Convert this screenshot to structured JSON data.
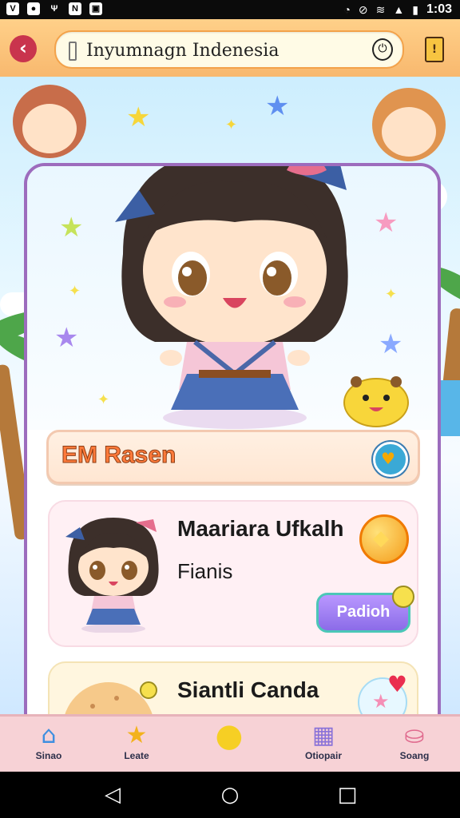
{
  "status_bar": {
    "time": "1:03",
    "left_icons": [
      "v-icon",
      "o-icon",
      "antenna-icon",
      "nfc-icon",
      "photo-icon"
    ],
    "right_icons": [
      "alarm-icon",
      "dnd-icon",
      "wifi-icon",
      "signal-icon",
      "battery-icon"
    ]
  },
  "app_bar": {
    "address_text": "Inyumnagn Indenesia"
  },
  "main_card": {
    "title": "EM Rasen",
    "items": [
      {
        "name": "Maariara Ufkalh",
        "subtitle": "Fianis",
        "button": "Padioh"
      },
      {
        "name": "Siantli Canda"
      }
    ]
  },
  "tab_bar": {
    "tabs": [
      {
        "label": "Sinao",
        "icon": "house-icon"
      },
      {
        "label": "Leate",
        "icon": "star-icon"
      },
      {
        "label": "",
        "icon": "fruit-icon"
      },
      {
        "label": "Otiopair",
        "icon": "shop-icon"
      },
      {
        "label": "Soang",
        "icon": "basket-icon"
      }
    ]
  },
  "colors": {
    "accent_back": "#c9344d",
    "card_border": "#9c6cbd",
    "title_text": "#ff7a3a",
    "tab_bar": "#f7d2d6"
  }
}
